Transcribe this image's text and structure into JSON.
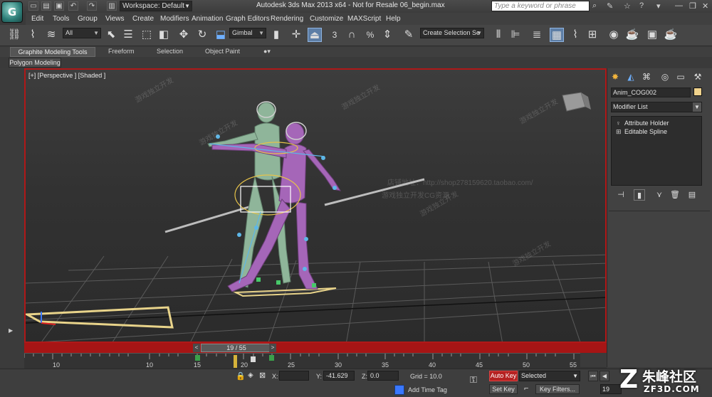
{
  "app": {
    "logo_glyph": "G",
    "title": "Autodesk 3ds Max  2013 x64  - Not for Resale   06_begin.max",
    "workspace": "Workspace: Default",
    "search_placeholder": "Type a keyword or phrase"
  },
  "menu": [
    "Edit",
    "Tools",
    "Group",
    "Views",
    "Create",
    "Modifiers",
    "Animation",
    "Graph Editors",
    "Rendering",
    "Customize",
    "MAXScript",
    "Help"
  ],
  "toolbar": {
    "selection_filter": "All",
    "ref_coord": "Gimbal",
    "named_selection": "Create Selection Se",
    "snap_label": "3"
  },
  "ribbon": {
    "tabs": [
      "Graphite Modeling Tools",
      "Freeform",
      "Selection",
      "Object Paint"
    ],
    "sub_tab": "Polygon Modeling"
  },
  "viewport": {
    "label": "[+] [Perspective ] [Shaded ]",
    "watermarks": [
      "游戏独立开发",
      "游戏独立开发",
      "游戏独立开发",
      "游戏独立开发",
      "游戏独立开发",
      "游戏独立开发",
      "游戏独立开发CG资源",
      "店铺地址：http://shop278159620.taobao.com/"
    ]
  },
  "timeline": {
    "slider": "19 / 55",
    "ticks": [
      "10",
      "15",
      "20",
      "25",
      "30",
      "35",
      "40",
      "45",
      "50",
      "55"
    ],
    "track_ticks": [
      "10",
      "10",
      "15",
      "20",
      "25",
      "30",
      "35",
      "40",
      "45",
      "50",
      "55"
    ]
  },
  "command_panel": {
    "object_name": "Anim_COG002",
    "object_color": "#f0d28c",
    "modifier_list": "Modifier List",
    "stack": [
      "Attribute Holder",
      "Editable Spline"
    ]
  },
  "status": {
    "x_label": "X:",
    "x_value": "",
    "y_label": "Y:",
    "y_value": "-41.629",
    "z_label": "Z:",
    "z_value": "0.0",
    "grid": "Grid = 10.0",
    "auto_key": "Auto Key",
    "set_key": "Set Key",
    "selected": "Selected",
    "key_filters": "Key Filters...",
    "add_time_tag": "Add Time Tag",
    "frame": "19"
  },
  "site_logo": {
    "name": "朱峰社区",
    "url": "ZF3D.COM"
  },
  "colors": {
    "accent_red": "#b01818",
    "active_blue": "#5d7ea6",
    "character_green": "#8fb59a",
    "character_purple": "#a566b8"
  }
}
